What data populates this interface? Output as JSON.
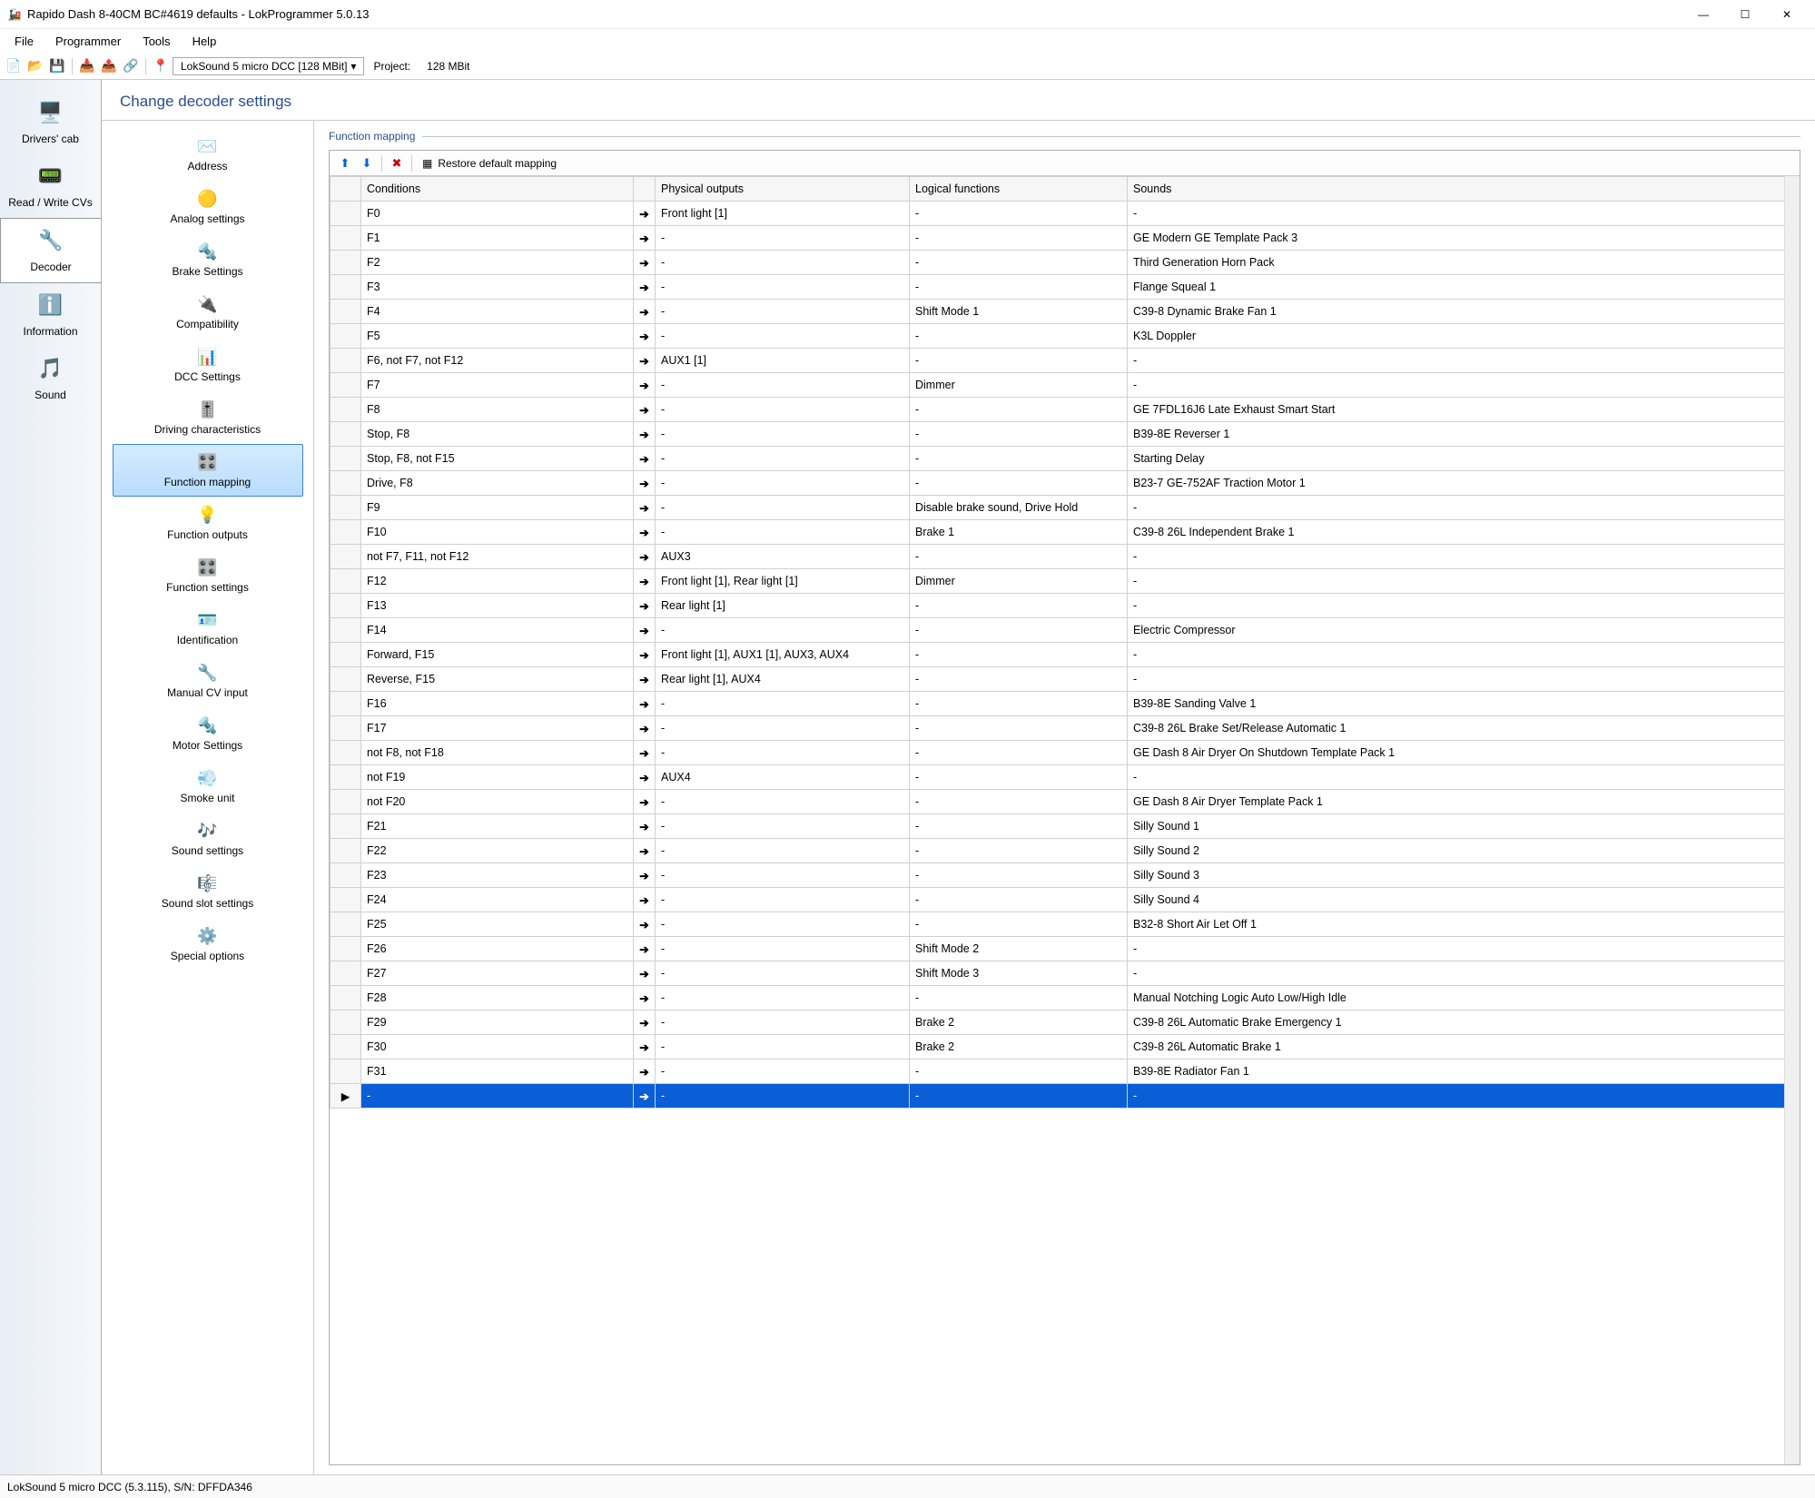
{
  "window": {
    "title": "Rapido Dash 8-40CM BC#4619 defaults - LokProgrammer 5.0.13"
  },
  "menubar": [
    "File",
    "Programmer",
    "Tools",
    "Help"
  ],
  "toolbar": {
    "decoder_name": "LokSound 5 micro DCC [128 MBit]",
    "project_label": "Project:",
    "project_value": "128 MBit"
  },
  "leftnav": [
    {
      "id": "drivers-cab",
      "label": "Drivers' cab",
      "icon": "🖥️"
    },
    {
      "id": "read-write-cvs",
      "label": "Read / Write CVs",
      "icon": "📟"
    },
    {
      "id": "decoder",
      "label": "Decoder",
      "icon": "🔧",
      "selected": true
    },
    {
      "id": "information",
      "label": "Information",
      "icon": "ℹ️"
    },
    {
      "id": "sound",
      "label": "Sound",
      "icon": "🎵"
    }
  ],
  "page_title": "Change decoder settings",
  "subnav": [
    {
      "id": "address",
      "label": "Address",
      "icon": "✉️"
    },
    {
      "id": "analog-settings",
      "label": "Analog settings",
      "icon": "🟡"
    },
    {
      "id": "brake-settings",
      "label": "Brake Settings",
      "icon": "🔩"
    },
    {
      "id": "compatibility",
      "label": "Compatibility",
      "icon": "🔌"
    },
    {
      "id": "dcc-settings",
      "label": "DCC Settings",
      "icon": "📊"
    },
    {
      "id": "driving-characteristics",
      "label": "Driving characteristics",
      "icon": "🎚️"
    },
    {
      "id": "function-mapping",
      "label": "Function mapping",
      "icon": "🎛️",
      "selected": true
    },
    {
      "id": "function-outputs",
      "label": "Function outputs",
      "icon": "💡"
    },
    {
      "id": "function-settings",
      "label": "Function settings",
      "icon": "🎛️"
    },
    {
      "id": "identification",
      "label": "Identification",
      "icon": "🪪"
    },
    {
      "id": "manual-cv-input",
      "label": "Manual CV input",
      "icon": "🔧"
    },
    {
      "id": "motor-settings",
      "label": "Motor Settings",
      "icon": "🔩"
    },
    {
      "id": "smoke-unit",
      "label": "Smoke unit",
      "icon": "💨"
    },
    {
      "id": "sound-settings",
      "label": "Sound settings",
      "icon": "🎶"
    },
    {
      "id": "sound-slot-settings",
      "label": "Sound slot settings",
      "icon": "🎼"
    },
    {
      "id": "special-options",
      "label": "Special options",
      "icon": "⚙️"
    }
  ],
  "section_title": "Function mapping",
  "grid_toolbar": {
    "restore": "Restore default mapping"
  },
  "columns": [
    "Conditions",
    "Physical outputs",
    "Logical functions",
    "Sounds"
  ],
  "rows": [
    {
      "c": "F0",
      "p": "Front light [1]",
      "l": "-",
      "s": "-"
    },
    {
      "c": "F1",
      "p": "-",
      "l": "-",
      "s": "GE Modern GE Template Pack 3"
    },
    {
      "c": "F2",
      "p": "-",
      "l": "-",
      "s": "Third Generation Horn Pack"
    },
    {
      "c": "F3",
      "p": "-",
      "l": "-",
      "s": "Flange Squeal 1"
    },
    {
      "c": "F4",
      "p": "-",
      "l": "Shift Mode 1",
      "s": "C39-8 Dynamic Brake Fan 1"
    },
    {
      "c": "F5",
      "p": "-",
      "l": "-",
      "s": "K3L Doppler"
    },
    {
      "c": "F6, not F7, not F12",
      "p": "AUX1 [1]",
      "l": "-",
      "s": "-"
    },
    {
      "c": "F7",
      "p": "-",
      "l": "Dimmer",
      "s": "-"
    },
    {
      "c": "F8",
      "p": "-",
      "l": "-",
      "s": "GE 7FDL16J6 Late Exhaust Smart Start"
    },
    {
      "c": "Stop, F8",
      "p": "-",
      "l": "-",
      "s": "B39-8E Reverser 1"
    },
    {
      "c": "Stop, F8, not F15",
      "p": "-",
      "l": "-",
      "s": "Starting Delay"
    },
    {
      "c": "Drive, F8",
      "p": "-",
      "l": "-",
      "s": "B23-7 GE-752AF Traction Motor 1"
    },
    {
      "c": "F9",
      "p": "-",
      "l": "Disable brake sound, Drive Hold",
      "s": "-"
    },
    {
      "c": "F10",
      "p": "-",
      "l": "Brake 1",
      "s": "C39-8 26L Independent Brake 1"
    },
    {
      "c": "not F7, F11, not F12",
      "p": "AUX3",
      "l": "-",
      "s": "-"
    },
    {
      "c": "F12",
      "p": "Front light [1], Rear light [1]",
      "l": "Dimmer",
      "s": "-"
    },
    {
      "c": "F13",
      "p": "Rear light [1]",
      "l": "-",
      "s": "-"
    },
    {
      "c": "F14",
      "p": "-",
      "l": "-",
      "s": "Electric Compressor"
    },
    {
      "c": "Forward, F15",
      "p": "Front light [1], AUX1 [1], AUX3, AUX4",
      "l": "-",
      "s": "-"
    },
    {
      "c": "Reverse, F15",
      "p": "Rear light [1], AUX4",
      "l": "-",
      "s": "-"
    },
    {
      "c": "F16",
      "p": "-",
      "l": "-",
      "s": "B39-8E Sanding Valve 1"
    },
    {
      "c": "F17",
      "p": "-",
      "l": "-",
      "s": "C39-8 26L Brake Set/Release Automatic 1"
    },
    {
      "c": "not F8, not F18",
      "p": "-",
      "l": "-",
      "s": "GE Dash 8 Air Dryer On Shutdown Template Pack 1"
    },
    {
      "c": "not F19",
      "p": "AUX4",
      "l": "-",
      "s": "-"
    },
    {
      "c": "not F20",
      "p": "-",
      "l": "-",
      "s": "GE Dash 8 Air Dryer Template Pack 1"
    },
    {
      "c": "F21",
      "p": "-",
      "l": "-",
      "s": "Silly Sound 1"
    },
    {
      "c": "F22",
      "p": "-",
      "l": "-",
      "s": "Silly Sound 2"
    },
    {
      "c": "F23",
      "p": "-",
      "l": "-",
      "s": "Silly Sound 3"
    },
    {
      "c": "F24",
      "p": "-",
      "l": "-",
      "s": "Silly Sound 4"
    },
    {
      "c": "F25",
      "p": "-",
      "l": "-",
      "s": "B32-8 Short Air Let Off 1"
    },
    {
      "c": "F26",
      "p": "-",
      "l": "Shift Mode 2",
      "s": "-"
    },
    {
      "c": "F27",
      "p": "-",
      "l": "Shift Mode 3",
      "s": "-"
    },
    {
      "c": "F28",
      "p": "-",
      "l": "-",
      "s": "Manual Notching Logic Auto Low/High Idle"
    },
    {
      "c": "F29",
      "p": "-",
      "l": "Brake 2",
      "s": "C39-8 26L Automatic Brake Emergency 1"
    },
    {
      "c": "F30",
      "p": "-",
      "l": "Brake 2",
      "s": "C39-8 26L Automatic Brake 1"
    },
    {
      "c": "F31",
      "p": "-",
      "l": "-",
      "s": "B39-8E Radiator Fan 1"
    },
    {
      "c": "-",
      "p": "-",
      "l": "-",
      "s": "-",
      "selected": true
    }
  ],
  "statusbar": "LokSound 5 micro DCC (5.3.115), S/N: DFFDA346"
}
